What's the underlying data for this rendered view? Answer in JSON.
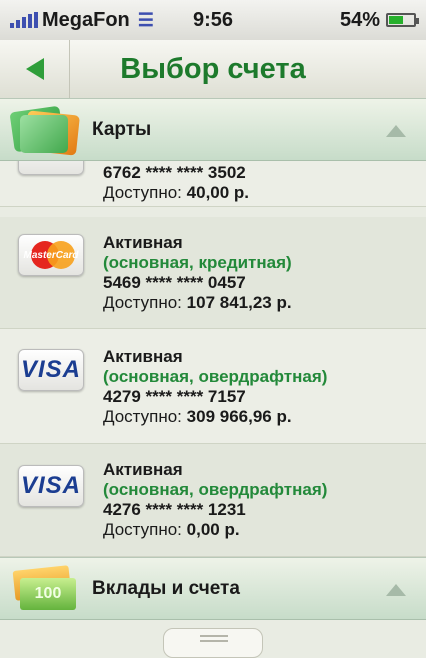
{
  "status_bar": {
    "carrier": "MegaFon",
    "time": "9:56",
    "battery": "54%",
    "battery_level": 0.54
  },
  "nav": {
    "title": "Выбор счета"
  },
  "sections": {
    "cards_label": "Карты",
    "deposits_label": "Вклады и счета",
    "deposits_icon_text": "100"
  },
  "accounts": [
    {
      "logo": "card",
      "number": "6762 **** **** 3502",
      "available_label": "Доступно:",
      "available_value": "40,00 р."
    },
    {
      "logo": "MasterCard",
      "status": "Активная",
      "type": "(основная, кредитная)",
      "number": "5469 **** **** 0457",
      "available_label": "Доступно:",
      "available_value": "107 841,23 р."
    },
    {
      "logo": "VISA",
      "status": "Активная",
      "type": "(основная, овердрафтная)",
      "number": "4279 **** **** 7157",
      "available_label": "Доступно:",
      "available_value": "309 966,96 р."
    },
    {
      "logo": "VISA",
      "status": "Активная",
      "type": "(основная, овердрафтная)",
      "number": "4276 **** **** 1231",
      "available_label": "Доступно:",
      "available_value": "0,00 р."
    }
  ],
  "colors": {
    "accent_green": "#1d7a2c",
    "type_green": "#23893a"
  }
}
